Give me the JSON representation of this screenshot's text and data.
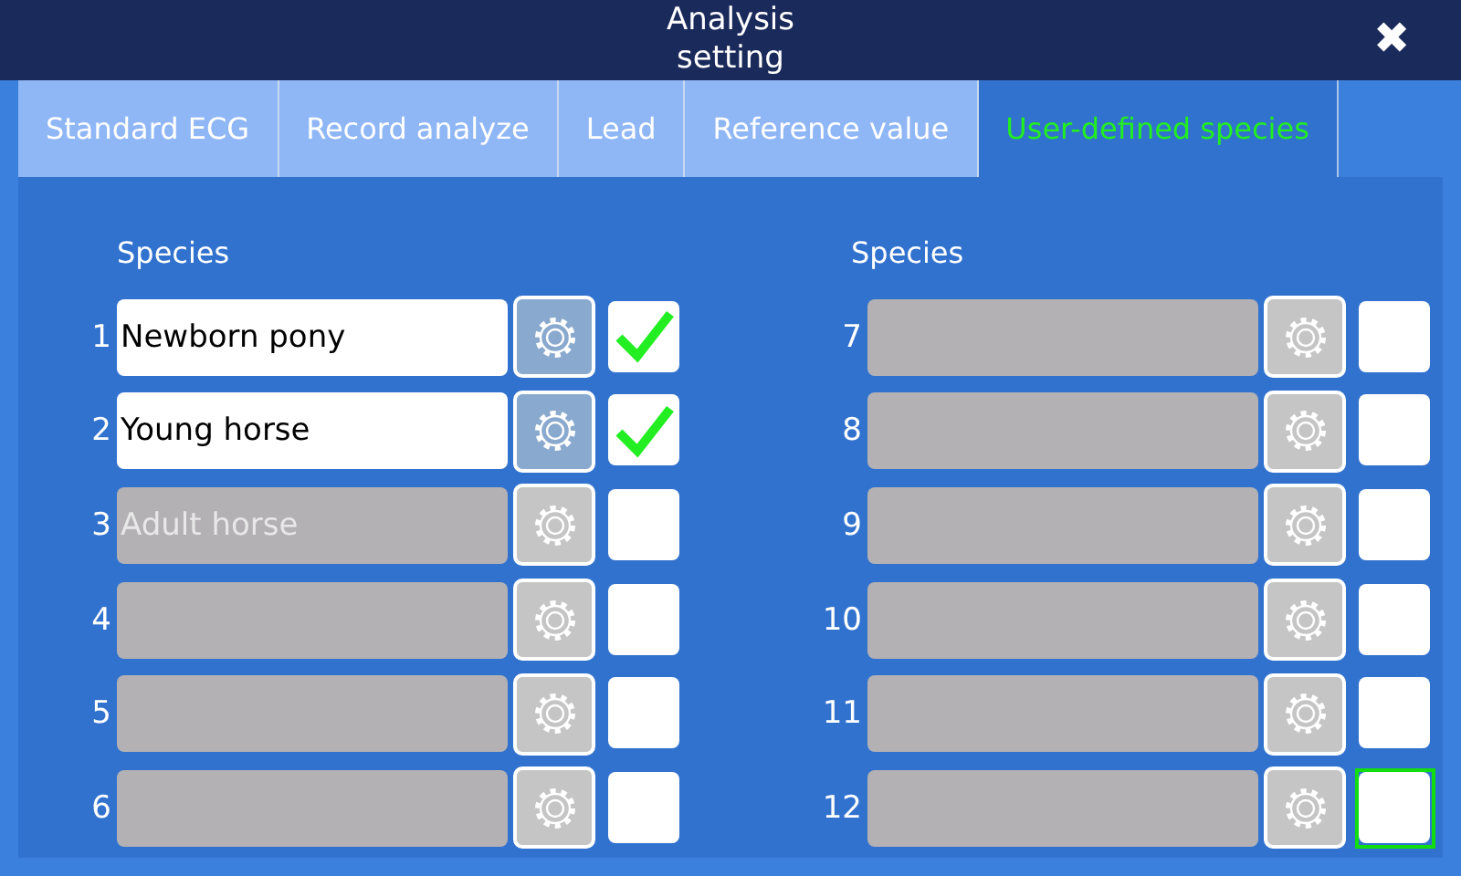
{
  "window": {
    "title_lines": [
      "Analysis",
      "setting"
    ]
  },
  "close_button": {
    "label": "✖"
  },
  "tabs": [
    {
      "label": "Standard ECG",
      "selected": false
    },
    {
      "label": "Record analyze",
      "selected": false
    },
    {
      "label": "Lead",
      "selected": false
    },
    {
      "label": "Reference value",
      "selected": false
    },
    {
      "label": "User-defined species",
      "selected": true
    }
  ],
  "columns": [
    {
      "heading": "Species",
      "rows": [
        {
          "number": "1",
          "name": "Newborn pony",
          "enabled": true,
          "checked": true,
          "focused": false
        },
        {
          "number": "2",
          "name": "Young horse",
          "enabled": true,
          "checked": true,
          "focused": false
        },
        {
          "number": "3",
          "name": "Adult horse",
          "enabled": false,
          "checked": false,
          "focused": false
        },
        {
          "number": "4",
          "enabled": false,
          "checked": false,
          "focused": false
        },
        {
          "number": "5",
          "enabled": false,
          "checked": false,
          "focused": false
        },
        {
          "number": "6",
          "enabled": false,
          "checked": false,
          "focused": false
        }
      ]
    },
    {
      "heading": "Species",
      "rows": [
        {
          "number": "7",
          "enabled": false,
          "checked": false,
          "focused": false
        },
        {
          "number": "8",
          "enabled": false,
          "checked": false,
          "focused": false
        },
        {
          "number": "9",
          "enabled": false,
          "checked": false,
          "focused": false
        },
        {
          "number": "10",
          "enabled": false,
          "checked": false,
          "focused": false
        },
        {
          "number": "11",
          "enabled": false,
          "checked": false,
          "focused": false
        },
        {
          "number": "12",
          "enabled": false,
          "checked": false,
          "focused": true
        }
      ]
    }
  ]
}
